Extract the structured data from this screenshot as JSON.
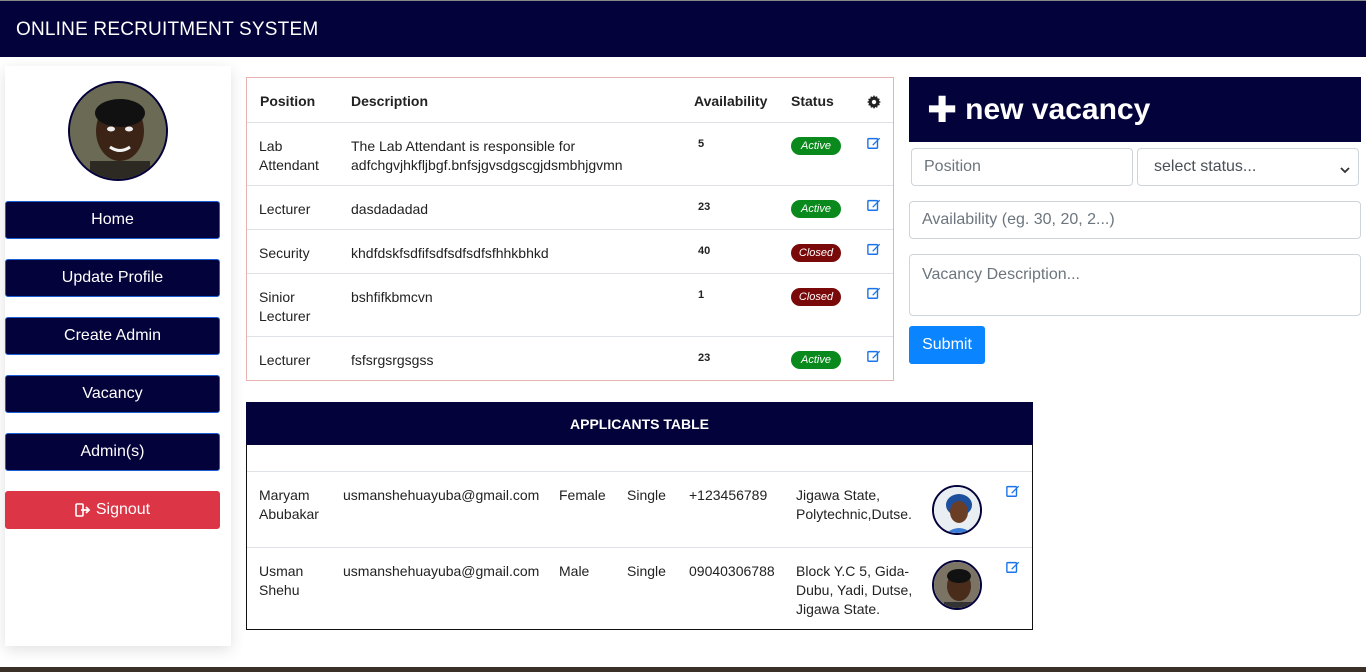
{
  "navbar": {
    "brand": "ONLINE RECRUITMENT SYSTEM"
  },
  "sidebar": {
    "avatar": "admin-avatar",
    "items": [
      {
        "label": "Home"
      },
      {
        "label": "Update Profile"
      },
      {
        "label": "Create Admin"
      },
      {
        "label": "Vacancy"
      },
      {
        "label": "Admin(s)"
      },
      {
        "label": "Signout"
      }
    ]
  },
  "vacancy_table": {
    "headers": [
      "Position",
      "Description",
      "Availability",
      "Status"
    ],
    "settings_icon": "gear-icon",
    "rows": [
      {
        "position": "Lab Attendant",
        "description": "The Lab Attendant is responsible for adfchgvjhkfljbgf.bnfsjgvsdgscgjdsmbhjgvmn",
        "availability": "5",
        "status": "Active"
      },
      {
        "position": "Lecturer",
        "description": "dasdadadad",
        "availability": "23",
        "status": "Active"
      },
      {
        "position": "Security",
        "description": "khdfdskfsdfifsdfsdfsdfsfhhkbhkd",
        "availability": "40",
        "status": "Closed"
      },
      {
        "position": "Sinior Lecturer",
        "description": "bshfifkbmcvn",
        "availability": "1",
        "status": "Closed"
      },
      {
        "position": "Lecturer",
        "description": "fsfsrgsrgsgss",
        "availability": "23",
        "status": "Active"
      }
    ]
  },
  "new_vacancy_form": {
    "title": "new vacancy",
    "position_placeholder": "Position",
    "status_selected": "select status...",
    "availability_placeholder": "Availability (eg. 30, 20, 2...)",
    "description_placeholder": "Vacancy Description...",
    "submit_label": "Submit"
  },
  "applicants_table": {
    "title": "APPLICANTS TABLE",
    "rows": [
      {
        "name": "Maryam Abubakar",
        "email": "usmanshehuayuba@gmail.com",
        "gender": "Female",
        "marital": "Single",
        "phone": "+123456789",
        "address": "Jigawa State, Polytechnic,Dutse."
      },
      {
        "name": "Usman Shehu",
        "email": "usmanshehuayuba@gmail.com",
        "gender": "Male",
        "marital": "Single",
        "phone": "09040306788",
        "address": "Block Y.C 5, Gida-Dubu, Yadi, Dutse, Jigawa State."
      }
    ]
  },
  "colors": {
    "navy": "#03023a",
    "active": "#0a8a1c",
    "closed": "#7a0a0a",
    "primary": "#0a84ff",
    "danger": "#dc3545"
  }
}
